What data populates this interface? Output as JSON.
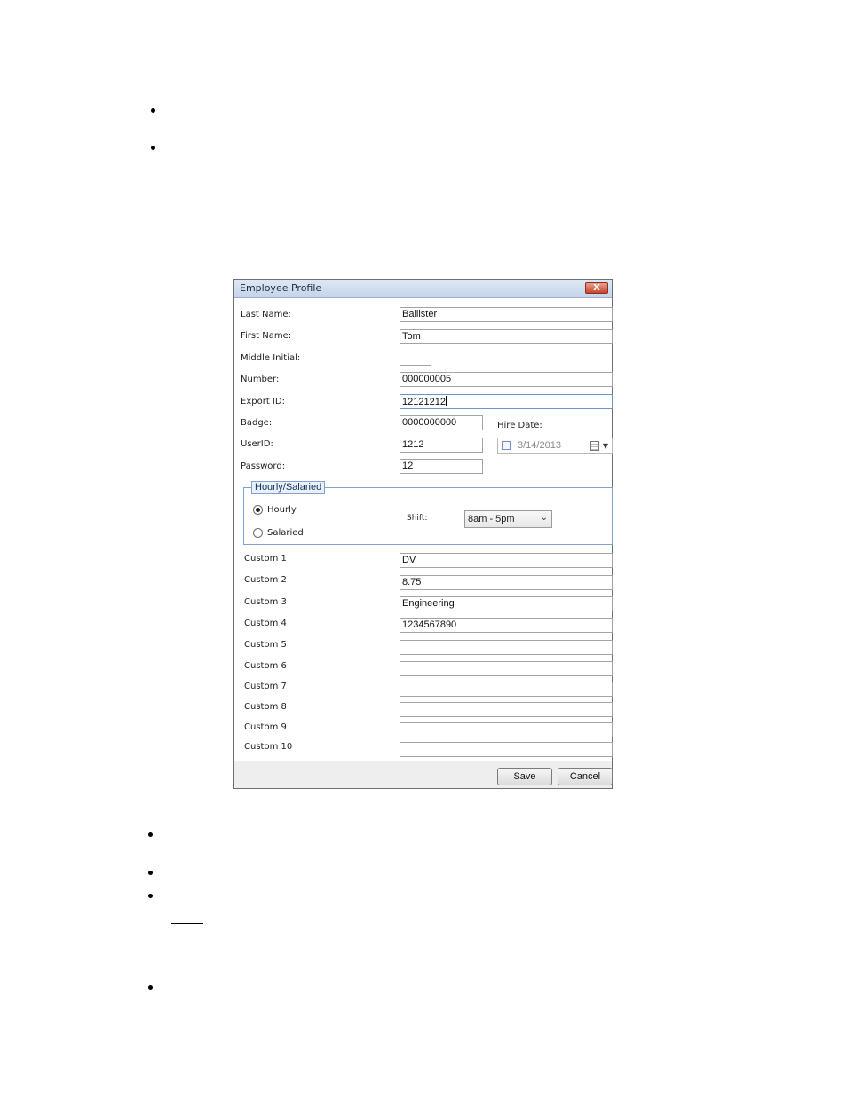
{
  "dialog": {
    "title": "Employee Profile",
    "close_label": "X",
    "fields": {
      "last_name": {
        "label": "Last Name:",
        "value": "Ballister"
      },
      "first_name": {
        "label": "First Name:",
        "value": "Tom"
      },
      "middle_initial": {
        "label": "Middle Initial:",
        "value": ""
      },
      "number": {
        "label": "Number:",
        "value": "000000005"
      },
      "export_id": {
        "label": "Export ID:",
        "value": "12121212"
      },
      "badge": {
        "label": "Badge:",
        "value": "0000000000"
      },
      "user_id": {
        "label": "UserID:",
        "value": "1212"
      },
      "password": {
        "label": "Password:",
        "value": "12"
      }
    },
    "hire_date": {
      "label": "Hire Date:",
      "value": "3/14/2013",
      "checked": false
    },
    "pay_type": {
      "legend": "Hourly/Salaried",
      "options": [
        {
          "label": "Hourly",
          "checked": true
        },
        {
          "label": "Salaried",
          "checked": false
        }
      ],
      "shift_label": "Shift:",
      "shift_value": "8am - 5pm"
    },
    "custom": [
      {
        "label": "Custom 1",
        "value": "DV"
      },
      {
        "label": "Custom 2",
        "value": "8.75"
      },
      {
        "label": "Custom 3",
        "value": "Engineering"
      },
      {
        "label": "Custom 4",
        "value": "1234567890"
      },
      {
        "label": "Custom 5",
        "value": ""
      },
      {
        "label": "Custom 6",
        "value": ""
      },
      {
        "label": "Custom 7",
        "value": ""
      },
      {
        "label": "Custom 8",
        "value": ""
      },
      {
        "label": "Custom 9",
        "value": ""
      },
      {
        "label": "Custom 10",
        "value": ""
      }
    ],
    "buttons": {
      "save": "Save",
      "cancel": "Cancel"
    }
  }
}
